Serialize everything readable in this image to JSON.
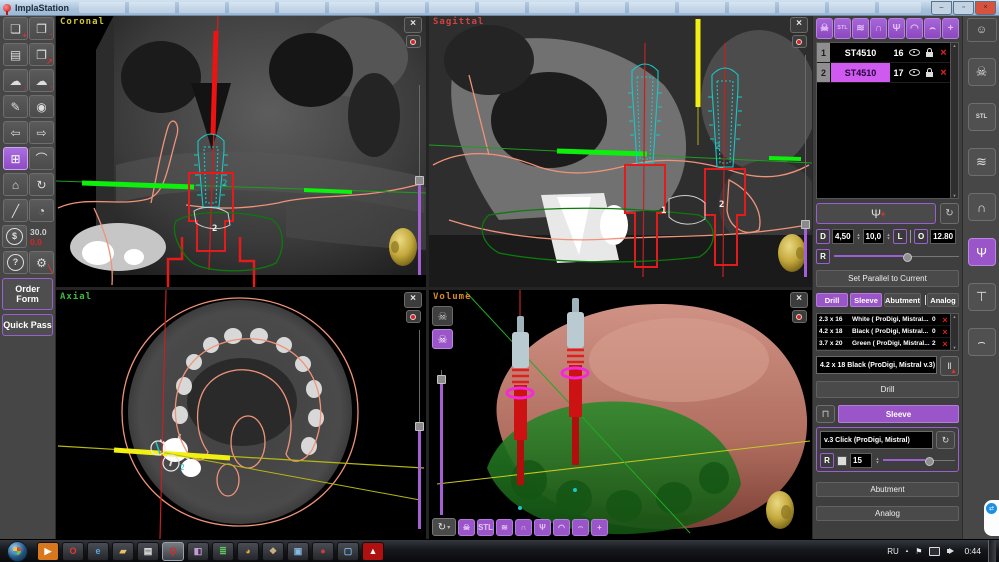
{
  "titlebar": {
    "title": "ImplaStation",
    "controls": [
      {
        "name": "minimize",
        "glyph": "–",
        "bg": "#c3d2e2"
      },
      {
        "name": "maximize",
        "glyph": "▫",
        "bg": "#c3d2e2"
      },
      {
        "name": "close",
        "glyph": "×",
        "bg": "#d9523e"
      }
    ]
  },
  "icons": {
    "expand": "×",
    "record_dot": "",
    "refresh": "↻",
    "rotate": "↻",
    "caret_down": "▾",
    "spin_up": "▲",
    "spin_down": "▼",
    "drill_tool": "Ⅱ",
    "drill_tool_accent": "▲",
    "sleeve_box": "⊓",
    "implant_glyph": "Ψ",
    "implant_accent": "+",
    "person": "☺",
    "skull": "☠",
    "flag": "⚑",
    "tv_arrows": "⇄"
  },
  "left_toolbar": {
    "buttons": [
      {
        "name": "new-case",
        "glyph": "❏",
        "accent": "+"
      },
      {
        "name": "open-case",
        "glyph": "❐",
        "accent": "↑"
      },
      {
        "name": "save-case",
        "glyph": "▤",
        "accent": ""
      },
      {
        "name": "export-case",
        "glyph": "❐",
        "accent": "↗"
      },
      {
        "name": "cloud-download",
        "glyph": "☁",
        "accent": "↓"
      },
      {
        "name": "cloud-upload",
        "glyph": "☁",
        "accent": "↑"
      },
      {
        "name": "report",
        "glyph": "✎",
        "accent": ""
      },
      {
        "name": "snapshot",
        "glyph": "◉",
        "accent": ""
      },
      {
        "name": "undo",
        "glyph": "⇦",
        "accent": ""
      },
      {
        "name": "redo",
        "glyph": "⇨",
        "accent": ""
      },
      {
        "name": "layout-grid",
        "glyph": "⊞",
        "accent": "",
        "selected": true
      },
      {
        "name": "panoramic-arch",
        "glyph": "⌒",
        "accent": ""
      },
      {
        "name": "home-view",
        "glyph": "⌂",
        "accent": ""
      },
      {
        "name": "rotate-view",
        "glyph": "↻",
        "accent": ""
      },
      {
        "name": "ruler",
        "glyph": "╱",
        "accent": ""
      },
      {
        "name": "protractor",
        "glyph": "◔",
        "accent": ""
      }
    ],
    "price_glyph": "$",
    "price_value_1": "30.0",
    "price_value_2": "0.0",
    "help_glyph": "?",
    "settings_glyph": "⚙",
    "order_form_label": "Order Form",
    "quick_pass_label": "Quick Pass"
  },
  "views": {
    "coronal": {
      "label": "Coronal",
      "marker_a": "2",
      "marker_b": "2"
    },
    "sagittal": {
      "label": "Sagittal",
      "marker_1": "1",
      "marker_2": "2",
      "marker_2b": "2"
    },
    "axial": {
      "label": "Axial",
      "marker": "2"
    },
    "volume": {
      "label": "Volume"
    }
  },
  "right_panel": {
    "toolbar": [
      {
        "name": "skull",
        "glyph": "☠",
        "small": false
      },
      {
        "name": "stl",
        "glyph": "STL",
        "small": true
      },
      {
        "name": "denture",
        "glyph": "≋",
        "small": false
      },
      {
        "name": "tooth",
        "glyph": "∩",
        "small": false
      },
      {
        "name": "implant",
        "glyph": "Ψ",
        "small": false
      },
      {
        "name": "sleeve",
        "glyph": "◠",
        "small": false
      },
      {
        "name": "arch-scan",
        "glyph": "⌢",
        "small": false
      },
      {
        "name": "add",
        "glyph": "+",
        "small": false
      }
    ],
    "implant_table": {
      "rows": [
        {
          "num": "1",
          "name": "ST4510",
          "tooth": "16",
          "selected": false
        },
        {
          "num": "2",
          "name": "ST4510",
          "tooth": "17",
          "selected": true
        }
      ]
    },
    "dims": {
      "d_label": "D",
      "d_value": "4,50",
      "len_value": "10,0",
      "l_label": "L",
      "o_label": "O",
      "o_value": "12.80",
      "r_label": "R"
    },
    "set_parallel_label": "Set Parallel to Current",
    "tabs": [
      {
        "label": "Drill",
        "active": true
      },
      {
        "label": "Sleeve",
        "active": true
      },
      {
        "label": "Abutment",
        "active": false
      },
      {
        "label": "Analog",
        "active": false
      }
    ],
    "drill_list": [
      {
        "size": "2.3 x 16",
        "desc": "White ( ProDigi, Mistral...",
        "count": "0"
      },
      {
        "size": "4.2 x 18",
        "desc": "Black ( ProDigi, Mistral...",
        "count": "0"
      },
      {
        "size": "3.7 x 20",
        "desc": "Green ( ProDigi, Mistral...",
        "count": "2"
      }
    ],
    "selected_drill": "4.2 x 18  Black (ProDigi, Mistral v.3)",
    "drill_button_label": "Drill",
    "sleeve_button_label": "Sleeve",
    "sleeve_model": "v.3 Click (ProDigi, Mistral)",
    "sleeve_r_label": "R",
    "sleeve_offset_value": "15",
    "abutment_button_label": "Abutment",
    "analog_button_label": "Analog"
  },
  "right_strip": [
    {
      "name": "skull",
      "glyph": "☠",
      "small": false,
      "selected": false
    },
    {
      "name": "stl",
      "glyph": "STL",
      "small": true,
      "selected": false
    },
    {
      "name": "denture",
      "glyph": "≋",
      "small": false,
      "selected": false
    },
    {
      "name": "tooth",
      "glyph": "∩",
      "small": false,
      "selected": false
    },
    {
      "name": "implant",
      "glyph": "Ψ",
      "small": false,
      "selected": true
    },
    {
      "name": "pin",
      "glyph": "⊤",
      "small": false,
      "selected": false
    },
    {
      "name": "arch",
      "glyph": "⌢",
      "small": false,
      "selected": false
    }
  ],
  "taskbar": {
    "apps": [
      {
        "name": "media-player",
        "glyph": "▶",
        "fg": "#fff",
        "bg": "#d8781e",
        "active": false
      },
      {
        "name": "opera",
        "glyph": "O",
        "fg": "#e23b30",
        "active": false
      },
      {
        "name": "internet-explorer",
        "glyph": "e",
        "fg": "#53a7dd",
        "active": false
      },
      {
        "name": "explorer-folder",
        "glyph": "▰",
        "fg": "#e8c060",
        "active": false
      },
      {
        "name": "notepad",
        "glyph": "▤",
        "fg": "#e6e6e6",
        "active": false
      },
      {
        "name": "implastation-app",
        "glyph": "Ϙ",
        "fg": "#d32b2b",
        "active": true
      },
      {
        "name": "graphics-tool",
        "glyph": "◧",
        "fg": "#c89bd8",
        "active": false
      },
      {
        "name": "codec-tool",
        "glyph": "≣",
        "fg": "#5cc45c",
        "active": false
      },
      {
        "name": "chrome",
        "glyph": "◕",
        "fg": "#e8a53a",
        "active": false
      },
      {
        "name": "file-manager",
        "glyph": "❖",
        "fg": "#cdb184",
        "active": false
      },
      {
        "name": "photo-viewer",
        "glyph": "▣",
        "fg": "#86b8e0",
        "active": false
      },
      {
        "name": "media-center",
        "glyph": "●",
        "fg": "#d33b3b",
        "active": false
      },
      {
        "name": "blue-app",
        "glyph": "▢",
        "fg": "#7ab2e8",
        "active": false
      },
      {
        "name": "adobe-reader",
        "glyph": "▲",
        "fg": "#fff",
        "bg": "#b01010",
        "active": false
      }
    ],
    "tray": {
      "lang": "RU",
      "caret": "▴",
      "time": "0:44"
    }
  }
}
